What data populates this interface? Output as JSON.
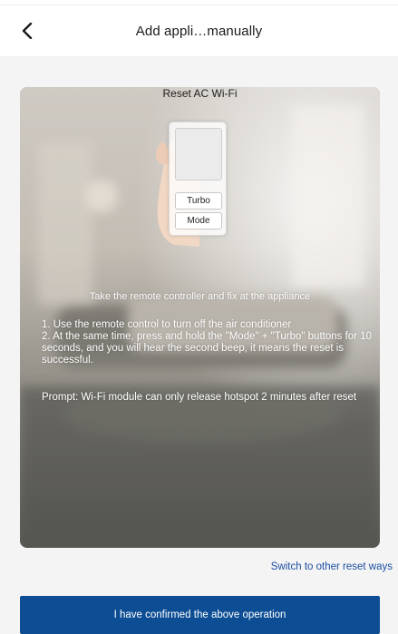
{
  "header": {
    "title": "Add appli…manually",
    "back_icon": "chevron-left-icon"
  },
  "card": {
    "title": "Reset AC Wi-Fi",
    "remote": {
      "turbo_label": "Turbo",
      "mode_label": "Mode"
    },
    "lead": "Take the remote controller and fix at the appliance",
    "steps": [
      "1. Use the remote control to turn off the air conditioner",
      "2. At the same time, press and hold the \"Mode\" + \"Turbo\" buttons for 10 seconds, and you will hear the second beep, it means the reset is successful."
    ],
    "prompt": "Prompt: Wi-Fi module can only release hotspot 2 minutes after reset"
  },
  "links": {
    "switch_reset": "Switch to other reset ways"
  },
  "actions": {
    "confirm_label": "I have confirmed the above operation"
  },
  "colors": {
    "accent": "#0d4d94",
    "link": "#1b4ea3"
  }
}
